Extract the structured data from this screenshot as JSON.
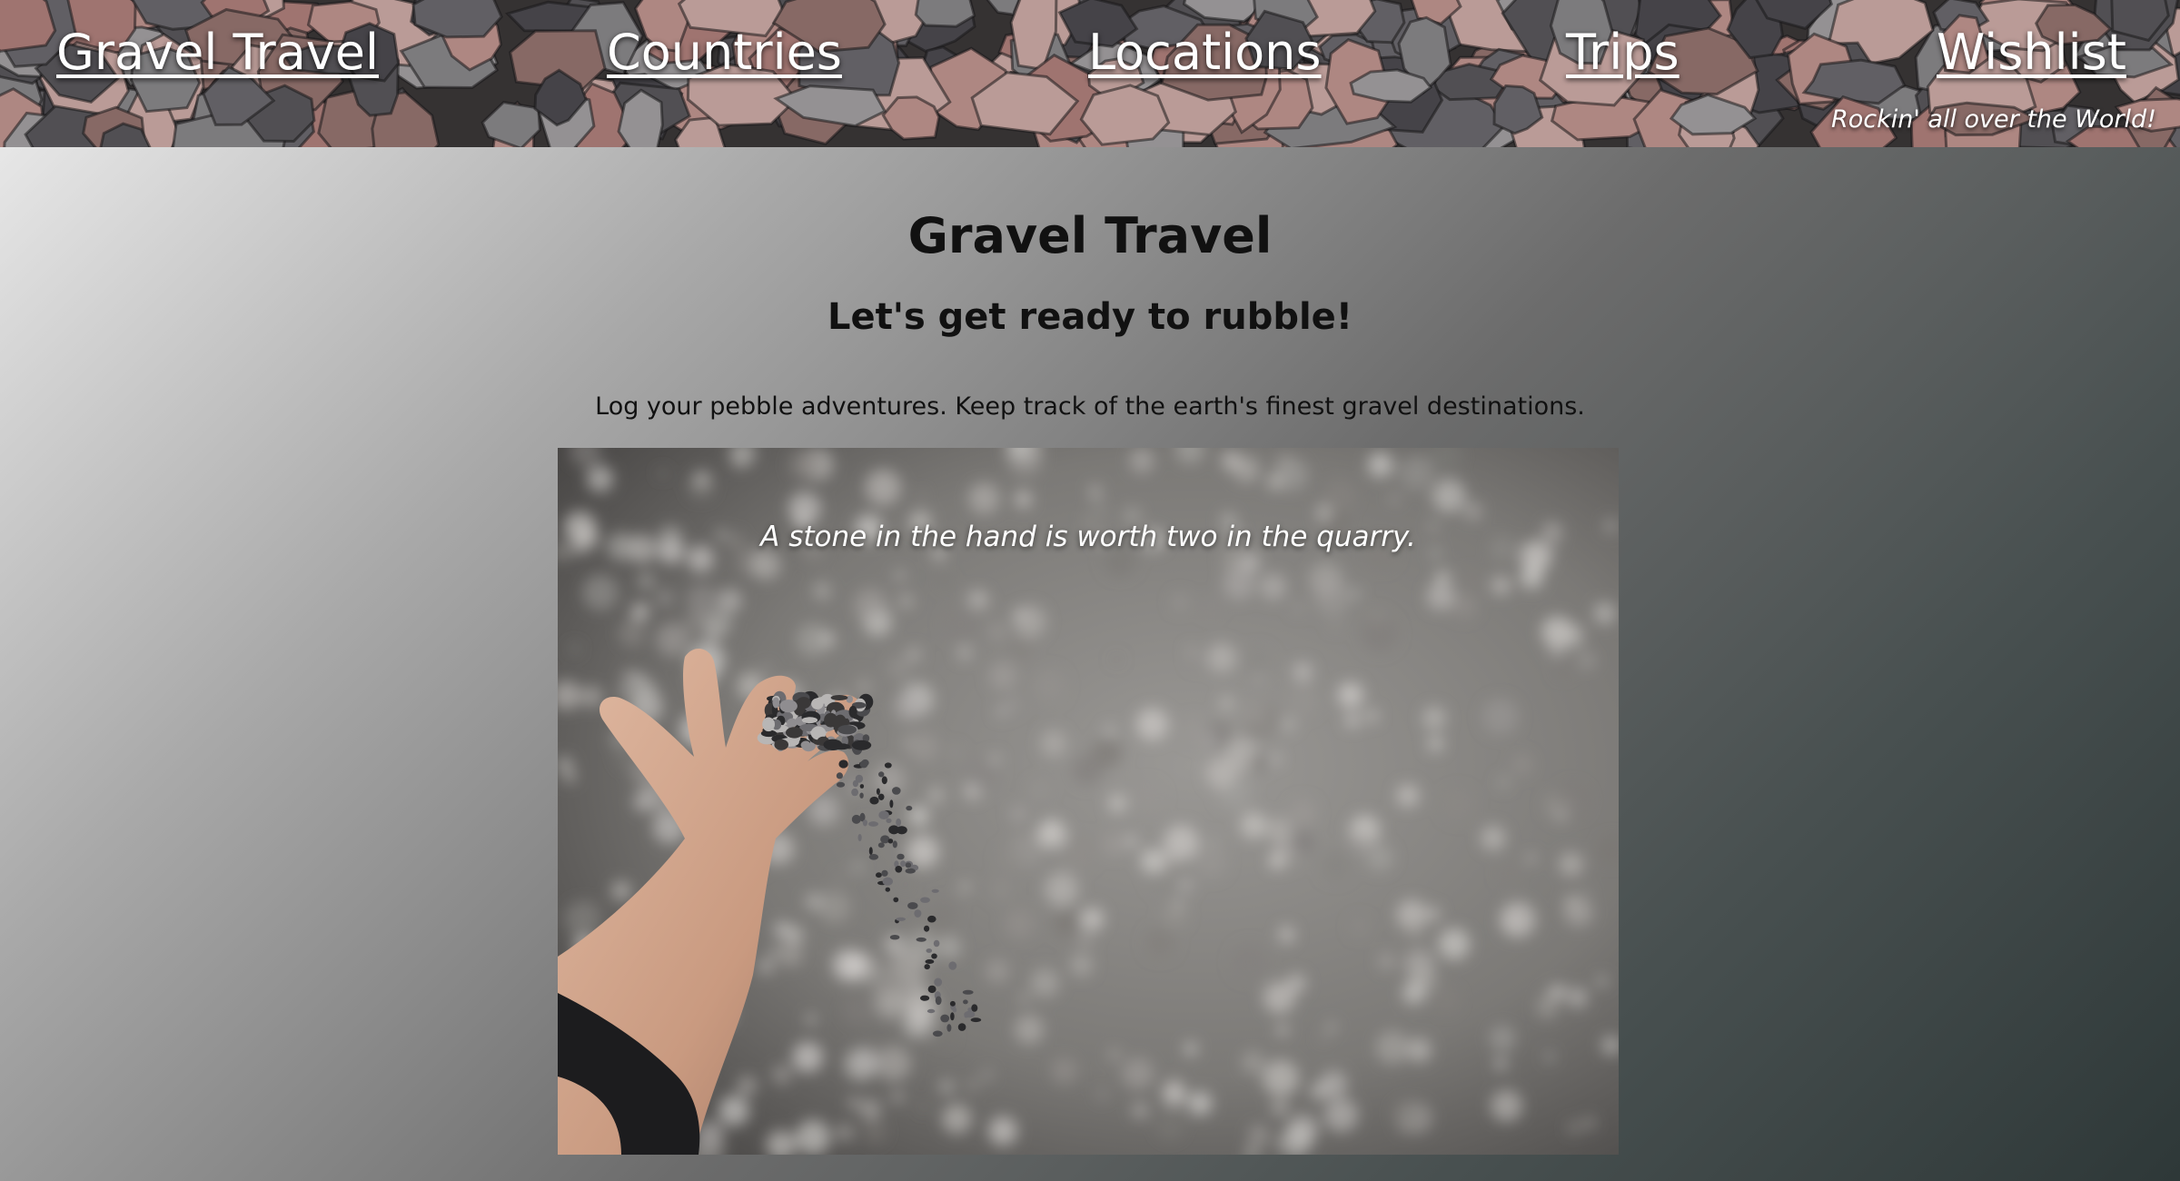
{
  "nav": {
    "items": [
      {
        "label": "Gravel Travel"
      },
      {
        "label": "Countries"
      },
      {
        "label": "Locations"
      },
      {
        "label": "Trips"
      },
      {
        "label": "Wishlist"
      }
    ],
    "tagline": "Rockin' all over the World!"
  },
  "main": {
    "title": "Gravel Travel",
    "subtitle": "Let's get ready to rubble!",
    "intro": "Log your pebble adventures. Keep track of the earth's finest gravel destinations.",
    "hero_quote": "A stone in the hand is worth two in the quarry."
  },
  "colors": {
    "nav_text": "#ffffff",
    "heading_text": "#111111",
    "gradient_light": "#f2f2f2",
    "gradient_dark": "#2e3838"
  }
}
